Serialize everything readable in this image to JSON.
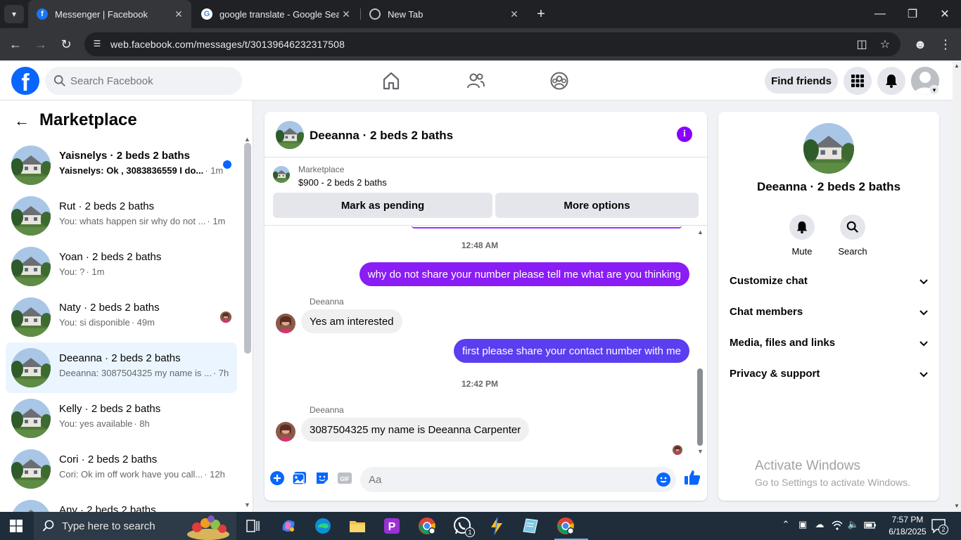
{
  "browser": {
    "tabs": [
      {
        "title": "Messenger | Facebook",
        "favicon": "facebook-icon",
        "active": true
      },
      {
        "title": "google translate - Google Search",
        "favicon": "google-icon",
        "active": false
      },
      {
        "title": "New Tab",
        "favicon": "chrome-icon",
        "active": false
      }
    ],
    "url": "web.facebook.com/messages/t/30139646232317508"
  },
  "header": {
    "search_placeholder": "Search Facebook",
    "find_friends": "Find friends",
    "accent": "#0866ff"
  },
  "sidebar": {
    "title": "Marketplace",
    "chats": [
      {
        "name": "Yaisnelys · 2 beds 2 baths",
        "snippet": "Yaisnelys: Ok , 3083836559 I do...",
        "time": " · 1m",
        "unread": true
      },
      {
        "name": "Rut · 2 beds 2 baths",
        "snippet": "You: whats happen sir why do not ...",
        "time": " · 1m",
        "unread": false
      },
      {
        "name": "Yoan · 2 beds 2 baths",
        "snippet": "You: ?",
        "time": " · 1m",
        "unread": false
      },
      {
        "name": "Naty · 2 beds 2 baths",
        "snippet": "You: si disponible",
        "time": " · 49m",
        "unread": false
      },
      {
        "name": "Deeanna · 2 beds 2 baths",
        "snippet": "Deeanna: 3087504325 my name is ...",
        "time": " · 7h",
        "unread": false,
        "selected": true
      },
      {
        "name": "Kelly · 2 beds 2 baths",
        "snippet": "You: yes available",
        "time": " · 8h",
        "unread": false
      },
      {
        "name": "Cori · 2 beds 2 baths",
        "snippet": "Cori: Ok im off work have you call...",
        "time": " · 12h",
        "unread": false
      },
      {
        "name": "Any · 2 beds 2 baths",
        "snippet": "",
        "time": "",
        "unread": false
      }
    ]
  },
  "conversation": {
    "title": "Deeanna · 2 beds 2 baths",
    "marketplace_label": "Marketplace",
    "listing": "$900 - 2 beds 2 baths",
    "mark_pending": "Mark as pending",
    "more_options": "More options",
    "messages": [
      {
        "type": "timestamp",
        "text": "12:48 AM"
      },
      {
        "type": "out",
        "text": "why do not share your number please tell me what are you thinking",
        "color": "#8a1cf5"
      },
      {
        "type": "sender",
        "text": "Deeanna"
      },
      {
        "type": "in",
        "text": "Yes am interested"
      },
      {
        "type": "out",
        "text": "first please share your contact number with me",
        "color": "#5a3ef0"
      },
      {
        "type": "timestamp",
        "text": "12:42 PM"
      },
      {
        "type": "sender",
        "text": "Deeanna"
      },
      {
        "type": "in",
        "text": "3087504325 my name is Deeanna Carpenter"
      }
    ],
    "input_placeholder": "Aa"
  },
  "details": {
    "name": "Deeanna · 2 beds 2 baths",
    "actions": [
      {
        "label": "Mute",
        "icon": "bell-icon"
      },
      {
        "label": "Search",
        "icon": "search-icon"
      }
    ],
    "sections": [
      "Customize chat",
      "Chat members",
      "Media, files and links",
      "Privacy & support"
    ]
  },
  "watermark": {
    "line1": "Activate Windows",
    "line2": "Go to Settings to activate Windows."
  },
  "taskbar": {
    "search_placeholder": "Type here to search",
    "time": "7:57 PM",
    "date": "6/18/2025",
    "whatsapp_badge": "1",
    "notif_count": "2"
  }
}
